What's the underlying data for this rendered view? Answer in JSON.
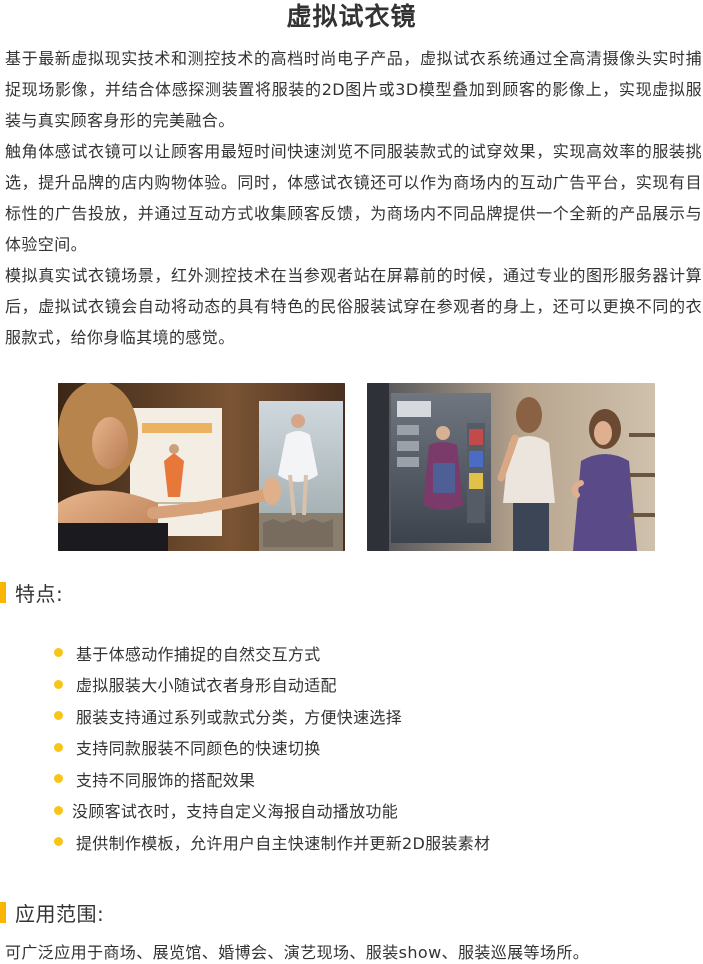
{
  "page": {
    "title": "虚拟试衣镜"
  },
  "intro": {
    "paragraphs": [
      "基于最新虚拟现实技术和测控技术的高档时尚电子产品，虚拟试衣系统通过全高清摄像头实时捕捉现场影像，并结合体感探测装置将服装的2D图片或3D模型叠加到顾客的影像上，实现虚拟服装与真实顾客身形的完美融合。",
      "触角体感试衣镜可以让顾客用最短时间快速浏览不同服装款式的试穿效果，实现高效率的服装挑选，提升品牌的店内购物体验。同时，体感试衣镜还可以作为商场内的互动广告平台，实现有目标性的广告投放，并通过互动方式收集顾客反馈，为商场内不同品牌提供一个全新的产品展示与体验空间。",
      "模拟真实试衣镜场景，红外测控技术在当参观者站在屏幕前的时候，通过专业的图形服务器计算后，虚拟试衣镜会自动将动态的具有特色的民俗服装试穿在参观者的身上，还可以更换不同的衣服款式，给你身临其境的感觉。"
    ]
  },
  "photos": {
    "left_icon": "woman-touching-virtual-mirror-photo",
    "right_icon": "women-trying-virtual-fitting-screen-photo"
  },
  "features": {
    "heading": "特点:",
    "items": [
      "基于体感动作捕捉的自然交互方式",
      "虚拟服装大小随试衣者身形自动适配",
      "服装支持通过系列或款式分类，方便快速选择",
      "支持同款服装不同颜色的快速切换",
      "支持不同服饰的搭配效果",
      "没顾客试衣时，支持自定义海报自动播放功能",
      "提供制作模板，允许用户自主快速制作并更新2D服装素材"
    ]
  },
  "scope": {
    "heading": "应用范围:",
    "text": "可广泛应用于商场、展览馆、婚博会、演艺现场、服装show、服装巡展等场所。"
  },
  "colors": {
    "accent": "#f7b500",
    "bullet": "#f7c418",
    "text": "#333333"
  }
}
